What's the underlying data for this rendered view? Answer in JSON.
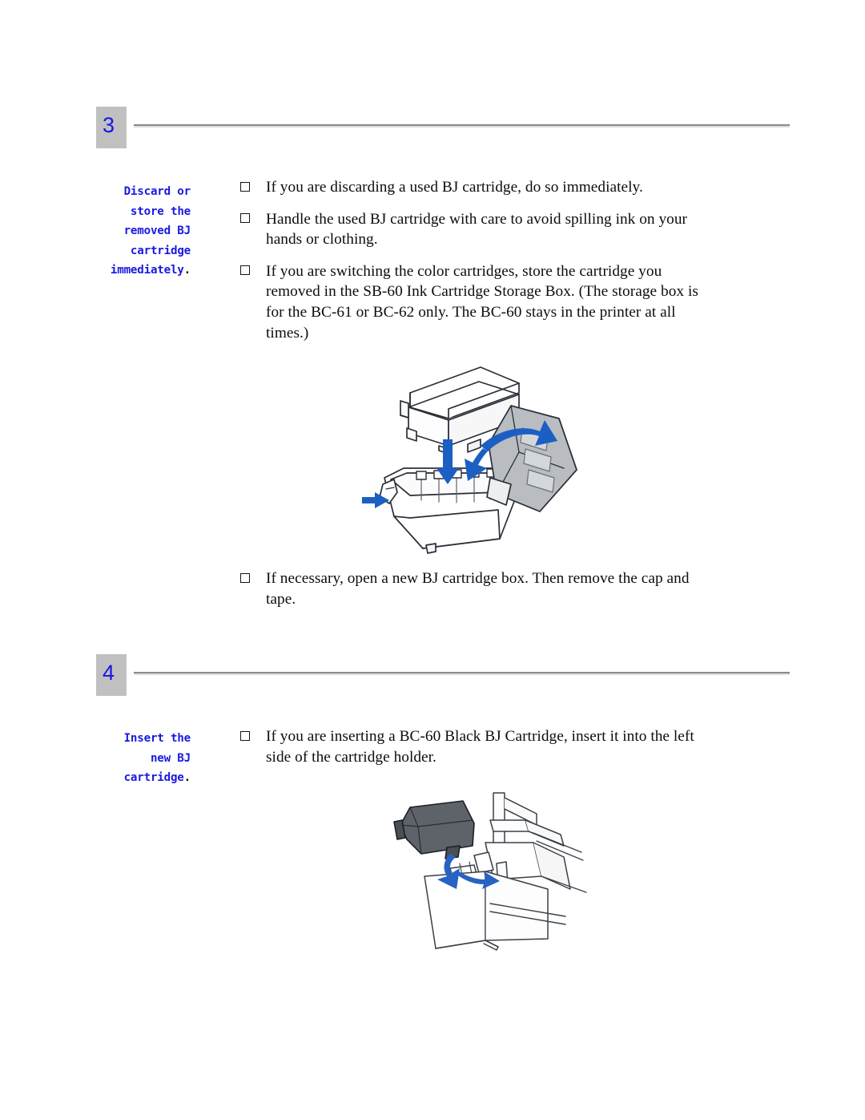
{
  "document": {
    "type": "printer-manual-page",
    "page_background": "#ffffff",
    "accent_blue": "#1a1ae0",
    "badge_gray": "#c0c0c0",
    "rule_dark": "#8a8a8a",
    "rule_light": "#dcdcdc"
  },
  "steps": [
    {
      "number": "3",
      "side_label_lines": [
        "Discard or",
        "store the",
        "removed BJ",
        "cartridge",
        "immediately"
      ],
      "side_label_period": ".",
      "bullets": [
        "If you are discarding a used BJ cartridge, do so immediately.",
        "Handle the used BJ cartridge with care to avoid spilling ink on your hands or clothing.",
        "If you are switching the color cartridges, store the cartridge you removed in the SB-60 Ink Cartridge Storage Box.  (The storage box is for the BC-61 or BC-62 only.   The BC-60 stays in the printer at all times.)"
      ],
      "figure": {
        "name": "cartridge-storage-box-illustration",
        "caption": "BJ cartridge lowering into the SB-60 Ink Cartridge Storage Box with hinged lid opening"
      },
      "bullets_after_figure": [
        "If necessary, open a new BJ cartridge box.  Then remove the cap and tape."
      ]
    },
    {
      "number": "4",
      "side_label_lines": [
        "Insert the",
        "new BJ",
        "cartridge"
      ],
      "side_label_period": ".",
      "bullets": [
        "If you are inserting a BC-60 Black BJ Cartridge, insert it into the left side of the cartridge holder."
      ],
      "figure": {
        "name": "cartridge-insertion-illustration",
        "caption": "Black BJ cartridge being inserted into the left side of the printer cartridge holder"
      }
    }
  ]
}
